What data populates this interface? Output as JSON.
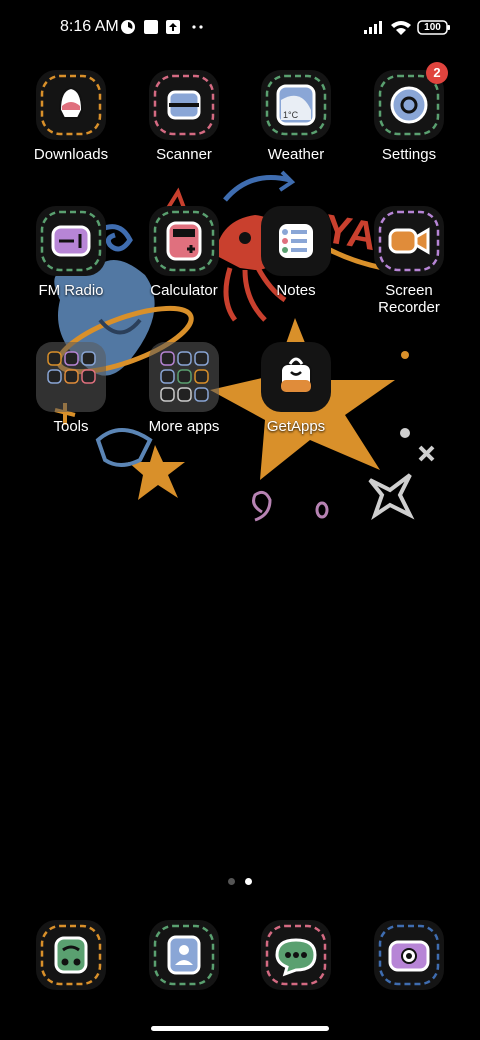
{
  "status_bar": {
    "time": "8:16 AM",
    "battery": "100",
    "icons": [
      "alarm-clock-icon",
      "square-notification-icon",
      "upload-notification-icon",
      "more-dots-icon",
      "signal-icon",
      "wifi-icon",
      "battery-icon"
    ]
  },
  "home": {
    "apps": [
      {
        "label": "Downloads",
        "icon": "downloads-icon"
      },
      {
        "label": "Scanner",
        "icon": "scanner-icon"
      },
      {
        "label": "Weather",
        "icon": "weather-icon",
        "icon_text": "1°C"
      },
      {
        "label": "Settings",
        "icon": "settings-icon",
        "badge": "2"
      },
      {
        "label": "FM Radio",
        "icon": "radio-icon"
      },
      {
        "label": "Calculator",
        "icon": "calculator-icon"
      },
      {
        "label": "Notes",
        "icon": "notes-icon"
      },
      {
        "label": "Screen Recorder",
        "icon": "screen-recorder-icon"
      },
      {
        "label": "Tools",
        "icon": "folder-icon"
      },
      {
        "label": "More apps",
        "icon": "folder-icon"
      },
      {
        "label": "GetApps",
        "icon": "getapps-icon"
      }
    ]
  },
  "page_indicator": {
    "pages": 2,
    "current": 2
  },
  "dock": [
    {
      "icon": "phone-icon"
    },
    {
      "icon": "contacts-icon"
    },
    {
      "icon": "messages-icon"
    },
    {
      "icon": "camera-icon"
    }
  ],
  "colors": {
    "background": "#000000",
    "badge": "#e0443e",
    "accent_orange": "#d9902a"
  }
}
